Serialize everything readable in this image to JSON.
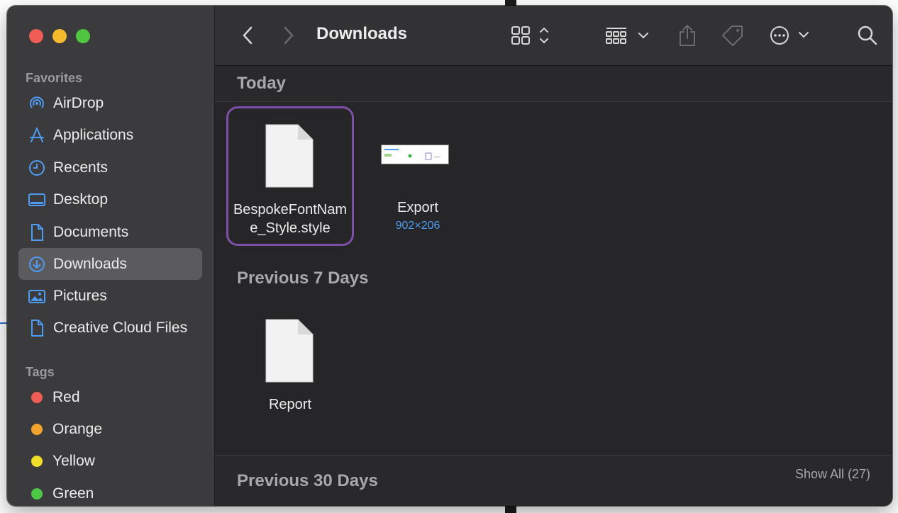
{
  "window": {
    "title": "Downloads"
  },
  "sidebar": {
    "favorites_heading": "Favorites",
    "favorites": [
      {
        "label": "AirDrop",
        "icon": "airdrop-icon"
      },
      {
        "label": "Applications",
        "icon": "applications-icon"
      },
      {
        "label": "Recents",
        "icon": "clock-icon"
      },
      {
        "label": "Desktop",
        "icon": "desktop-icon"
      },
      {
        "label": "Documents",
        "icon": "document-icon"
      },
      {
        "label": "Downloads",
        "icon": "download-icon",
        "selected": true
      },
      {
        "label": "Pictures",
        "icon": "pictures-icon"
      },
      {
        "label": "Creative Cloud Files",
        "icon": "file-icon"
      }
    ],
    "tags_heading": "Tags",
    "tags": [
      {
        "label": "Red",
        "color": "#ee5e56"
      },
      {
        "label": "Orange",
        "color": "#f4a32f"
      },
      {
        "label": "Yellow",
        "color": "#f0de2b"
      },
      {
        "label": "Green",
        "color": "#4cc746"
      }
    ]
  },
  "sections": {
    "today": {
      "title": "Today",
      "files": [
        {
          "name_line1": "BespokeFontNam",
          "name_line2": "e_Style.style",
          "selected": true
        },
        {
          "name_line1": "Export",
          "dimensions": "902×206"
        }
      ]
    },
    "previous7": {
      "title": "Previous 7 Days",
      "files": [
        {
          "name_line1": "Report"
        }
      ]
    },
    "previous30": {
      "title": "Previous 30 Days",
      "show_all": "Show All (27)"
    }
  },
  "colors": {
    "accent": "#4e9cf2",
    "selection_ring": "#7d4fa8"
  }
}
